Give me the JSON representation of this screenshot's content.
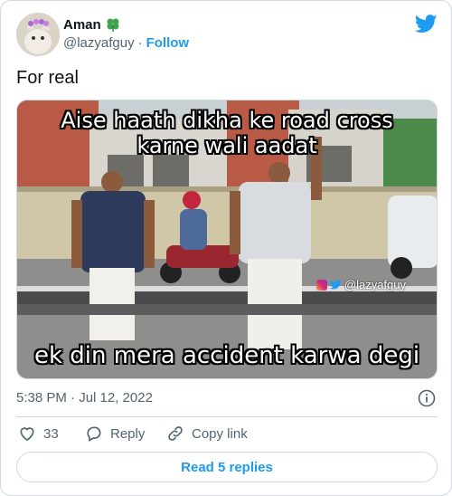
{
  "author": {
    "name": "Aman",
    "handle": "@lazyafguy",
    "separator": "·",
    "follow_label": "Follow"
  },
  "tweet": {
    "text": "For real",
    "timestamp": "5:38 PM · Jul 12, 2022"
  },
  "media": {
    "caption_top_line1": "Aise haath dikha ke road cross",
    "caption_top_line2": "karne wali aadat",
    "caption_bottom": "ek din mera accident karwa degi",
    "watermark": "@lazyafguy"
  },
  "actions": {
    "like_count": "33",
    "reply_label": "Reply",
    "copy_label": "Copy link"
  },
  "replies_button": "Read 5 replies",
  "colors": {
    "accent": "#1d9bf0",
    "muted": "#536471",
    "border": "#cfd9de"
  }
}
